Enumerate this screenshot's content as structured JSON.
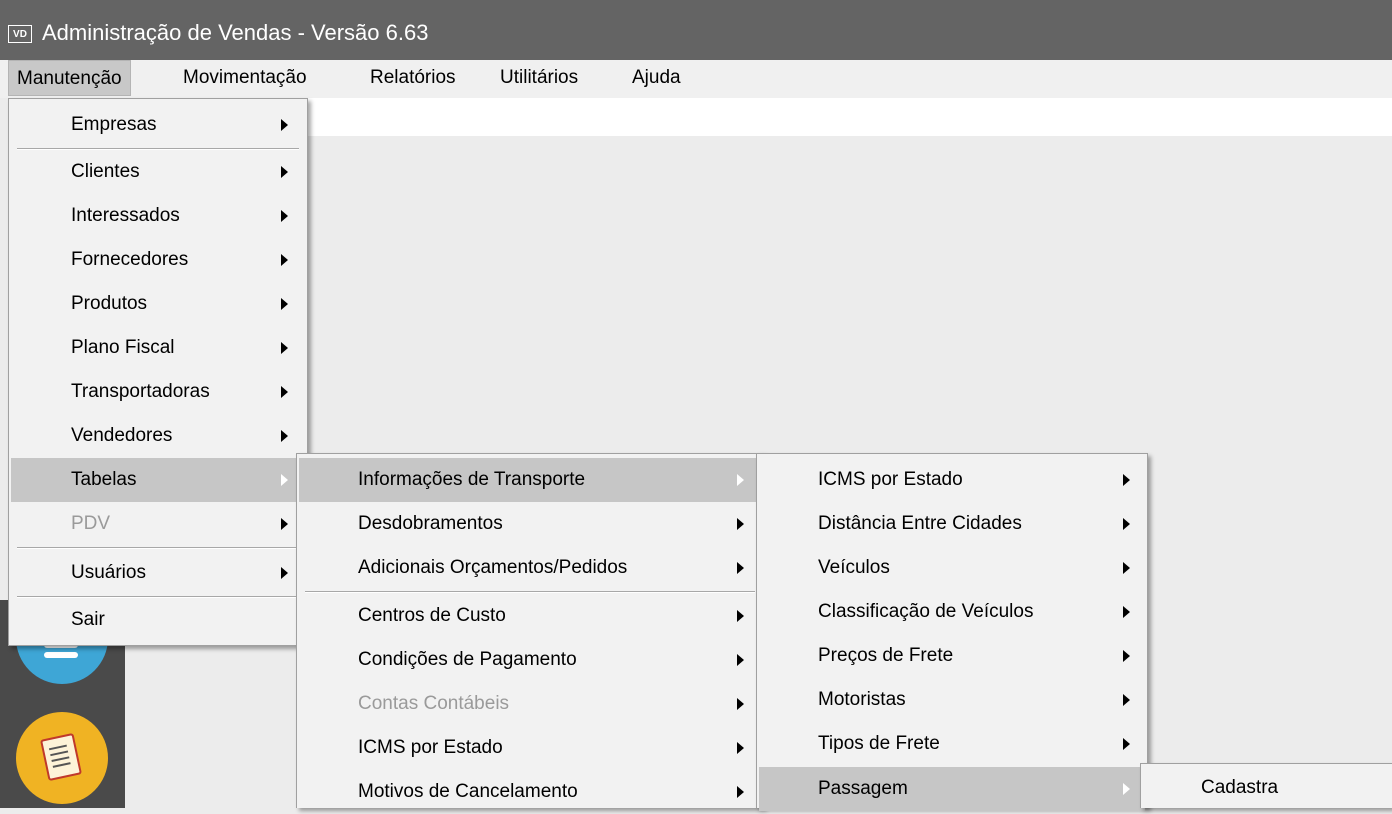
{
  "window": {
    "app_icon_text": "VD",
    "title": "Administração de Vendas - Versão 6.63"
  },
  "menubar": {
    "items": [
      {
        "label": "Manutenção"
      },
      {
        "label": "Movimentação"
      },
      {
        "label": "Relatórios"
      },
      {
        "label": "Utilitários"
      },
      {
        "label": "Ajuda"
      }
    ]
  },
  "menu_manutencao": {
    "items": [
      {
        "label": "Empresas"
      },
      {
        "label": "Clientes"
      },
      {
        "label": "Interessados"
      },
      {
        "label": "Fornecedores"
      },
      {
        "label": "Produtos"
      },
      {
        "label": "Plano Fiscal"
      },
      {
        "label": "Transportadoras"
      },
      {
        "label": "Vendedores"
      },
      {
        "label": "Tabelas"
      },
      {
        "label": "PDV"
      },
      {
        "label": "Usuários"
      },
      {
        "label": "Sair"
      }
    ],
    "highlighted": "Tabelas",
    "disabled": [
      "PDV"
    ]
  },
  "menu_tabelas": {
    "items": [
      {
        "label": "Informações de Transporte"
      },
      {
        "label": "Desdobramentos"
      },
      {
        "label": "Adicionais Orçamentos/Pedidos"
      },
      {
        "label": "Centros de Custo"
      },
      {
        "label": "Condições de Pagamento"
      },
      {
        "label": "Contas Contábeis"
      },
      {
        "label": "ICMS por Estado"
      },
      {
        "label": "Motivos de Cancelamento"
      }
    ],
    "highlighted": "Informações de Transporte",
    "disabled": [
      "Contas Contábeis"
    ]
  },
  "menu_transporte": {
    "items": [
      {
        "label": "ICMS por Estado"
      },
      {
        "label": "Distância Entre Cidades"
      },
      {
        "label": "Veículos"
      },
      {
        "label": "Classificação de Veículos"
      },
      {
        "label": "Preços de Frete"
      },
      {
        "label": "Motoristas"
      },
      {
        "label": "Tipos de Frete"
      },
      {
        "label": "Passagem"
      }
    ],
    "highlighted": "Passagem"
  },
  "menu_passagem": {
    "items": [
      {
        "label": "Cadastra"
      }
    ]
  },
  "colors": {
    "titlebar": "#646464",
    "menu_background": "#f2f2f2",
    "highlight": "#c6c6c6",
    "workspace": "#ececec"
  }
}
